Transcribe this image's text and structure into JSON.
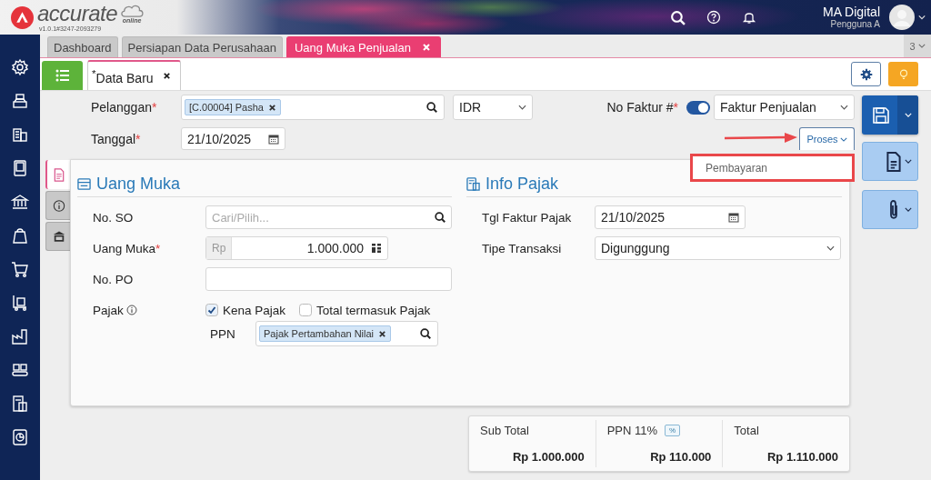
{
  "header": {
    "logo_text": "accurate",
    "logo_sub": "online",
    "version": "v1.0.1#3247-2093279",
    "user_name": "MA Digital",
    "user_role": "Pengguna A"
  },
  "tabs": [
    {
      "label": "Dashboard",
      "selected": false,
      "closable": false
    },
    {
      "label": "Persiapan Data Perusahaan",
      "selected": false,
      "closable": false
    },
    {
      "label": "Uang Muka Penjualan",
      "selected": true,
      "closable": true
    }
  ],
  "tab_count": "3",
  "doc_tab": {
    "label": "$^{*}$Data Baru",
    "selected": true
  },
  "form": {
    "customer": {
      "label": "Pelanggan",
      "mark": "*",
      "tag": "[C.00004] Pasha"
    },
    "currency": "IDR",
    "invoice": {
      "label": "No Faktur #",
      "mark": "*",
      "on": true,
      "value": "Faktur Penjualan"
    },
    "date": {
      "label": "Tanggal",
      "mark": "*",
      "value": "21/10/2025"
    }
  },
  "process": {
    "label": "Proses",
    "menu": [
      {
        "label": "Pembayaran",
        "highlighted": true
      }
    ]
  },
  "side_tabs": [
    {
      "kind": "document",
      "selected": true
    },
    {
      "kind": "info",
      "selected": false
    },
    {
      "kind": "bank",
      "selected": false
    }
  ],
  "down_payment": {
    "title": "Uang Muka",
    "so": {
      "label": "No. SO",
      "placeholder": "Cari/Pilih..."
    },
    "amount": {
      "label": "Uang Muka",
      "mark": "*",
      "prefix": "Rp",
      "value": "1.000.000"
    },
    "po": {
      "label": "No. PO"
    },
    "tax": {
      "label": "Pajak",
      "options": [
        {
          "label": "Kena Pajak",
          "checked": true
        },
        {
          "label": "Total termasuk Pajak",
          "checked": false
        }
      ],
      "ppn_label": "PPN",
      "ppn_tag": "Pajak Pertambahan Nilai"
    }
  },
  "tax_info": {
    "title": "Info Pajak",
    "date_label": "Tgl Faktur Pajak",
    "date": "21/10/2025",
    "type_label": "Tipe Transaksi",
    "type": "Digunggung"
  },
  "summary": [
    {
      "label": "Sub Total",
      "value": "Rp 1.000.000"
    },
    {
      "label": "PPN 11%",
      "badge": "%",
      "value": "Rp 110.000"
    },
    {
      "label": "Total",
      "value": "Rp 1.110.000"
    }
  ]
}
